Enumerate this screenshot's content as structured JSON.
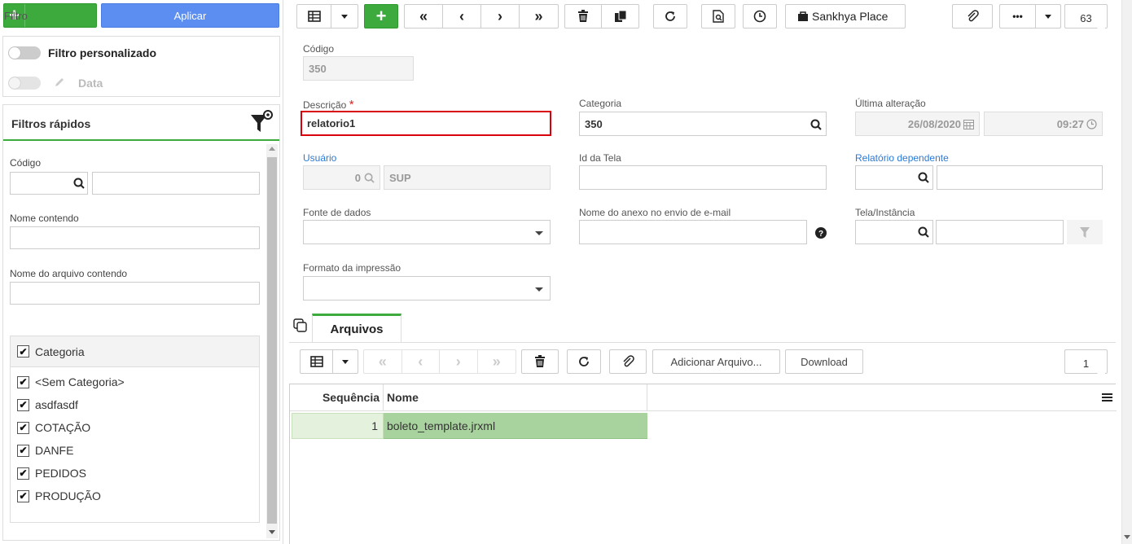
{
  "left": {
    "filtro_label": "Filtro",
    "aplicar_label": "Aplicar",
    "filtro_personalizado": "Filtro personalizado",
    "data_label": "Data",
    "filtros_rapidos": "Filtros rápidos",
    "codigo_label": "Código",
    "nome_contendo_label": "Nome contendo",
    "nome_arquivo_label": "Nome do arquivo contendo",
    "categoria_header": "Categoria",
    "categorias": [
      "<Sem Categoria>",
      "asdfasdf",
      "COTAÇÃO",
      "DANFE",
      "PEDIDOS",
      "PRODUÇÃO"
    ]
  },
  "toolbar": {
    "sankhya_place": "Sankhya Place",
    "more": "•••",
    "record_count": "63"
  },
  "form": {
    "codigo_label": "Código",
    "codigo_value": "350",
    "descricao_label": "Descrição",
    "descricao_value": "relatorio1",
    "categoria_label": "Categoria",
    "categoria_value": "350",
    "ultima_alteracao_label": "Última alteração",
    "data_value": "26/08/2020",
    "hora_value": "09:27",
    "usuario_label": "Usuário",
    "usuario_code": "0",
    "usuario_name": "SUP",
    "id_tela_label": "Id da Tela",
    "relatorio_dependente_label": "Relatório dependente",
    "fonte_dados_label": "Fonte de dados",
    "nome_anexo_label": "Nome do anexo no envio de e-mail",
    "tela_instancia_label": "Tela/Instância",
    "formato_impressao_label": "Formato da impressão"
  },
  "tabs": {
    "arquivos": "Arquivos"
  },
  "files_toolbar": {
    "adicionar": "Adicionar Arquivo...",
    "download": "Download",
    "count": "1"
  },
  "grid": {
    "headers": [
      "Sequência",
      "Nome"
    ],
    "rows": [
      {
        "seq": "1",
        "nome": "boleto_template.jrxml"
      }
    ]
  },
  "colors": {
    "green": "#3daa3d",
    "blue": "#5b8ef0",
    "highlight_red": "#d9000d",
    "row_green": "#a9d39e"
  }
}
